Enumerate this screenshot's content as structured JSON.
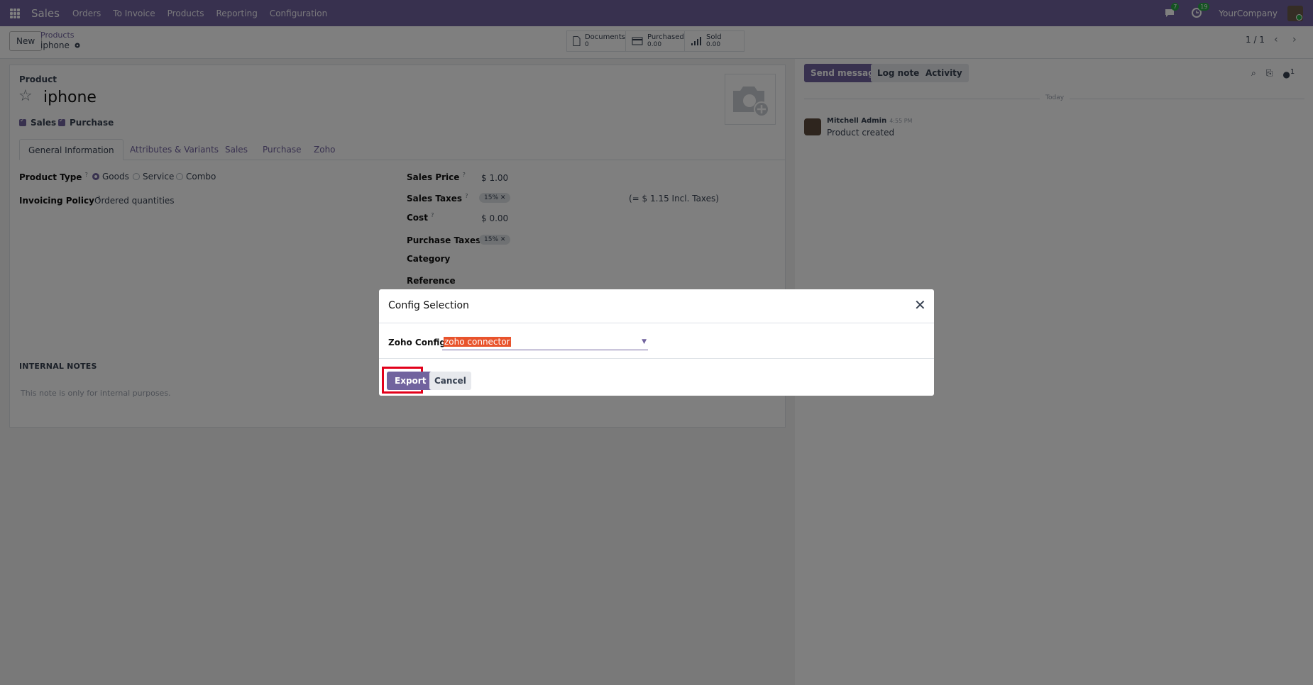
{
  "navbar": {
    "app_name": "Sales",
    "menu": [
      "Orders",
      "To Invoice",
      "Products",
      "Reporting",
      "Configuration"
    ],
    "messages_count": "7",
    "activities_count": "19",
    "company": "YourCompany"
  },
  "control_panel": {
    "new_label": "New",
    "breadcrumb_parent": "Products",
    "breadcrumb_current": "iphone",
    "smart_buttons": [
      {
        "label": "Documents",
        "value": "0",
        "icon": "document-icon"
      },
      {
        "label": "Purchased",
        "value": "0.00",
        "icon": "credit-card-icon"
      },
      {
        "label": "Sold",
        "value": "0.00",
        "icon": "bar-chart-icon"
      }
    ],
    "pager": "1 / 1"
  },
  "form": {
    "product_label": "Product",
    "product_name": "iphone",
    "sales_checkbox": "Sales",
    "purchase_checkbox": "Purchase",
    "tabs": [
      "General Information",
      "Attributes & Variants",
      "Sales",
      "Purchase",
      "Zoho"
    ],
    "product_type_label": "Product Type",
    "product_type_options": [
      "Goods",
      "Service",
      "Combo"
    ],
    "invoicing_policy_label": "Invoicing Policy",
    "invoicing_policy_value": "Ordered quantities",
    "sales_price_label": "Sales Price",
    "sales_price_value": "$ 1.00",
    "sales_taxes_label": "Sales Taxes",
    "sales_taxes_tag": "15%",
    "incl_taxes": "(= $ 1.15 Incl. Taxes)",
    "cost_label": "Cost",
    "cost_value": "$ 0.00",
    "purchase_taxes_label": "Purchase Taxes",
    "purchase_taxes_tag": "15%",
    "category_label": "Category",
    "reference_label": "Reference",
    "help_marker": "?",
    "notes_title": "INTERNAL NOTES",
    "notes_placeholder": "This note is only for internal purposes."
  },
  "chatter": {
    "send_message": "Send message",
    "log_note": "Log note",
    "activity": "Activity",
    "followers_count": "1",
    "today": "Today",
    "author": "Mitchell Admin",
    "time": "4:55 PM",
    "message": "Product created"
  },
  "dialog": {
    "title": "Config Selection",
    "field_label": "Zoho Config",
    "field_value": "zoho connector",
    "export_label": "Export",
    "cancel_label": "Cancel"
  },
  "colors": {
    "brand": "#71639e",
    "highlight": "#e2001a",
    "selection": "#e8532c"
  }
}
